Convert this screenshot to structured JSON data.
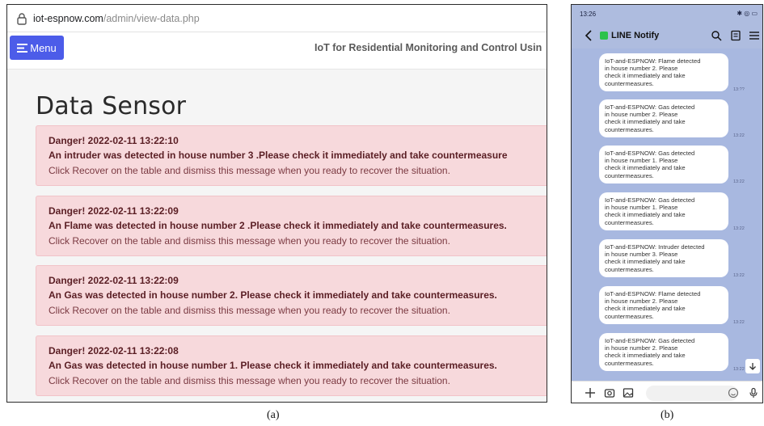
{
  "browser": {
    "url_domain": "iot-espnow.com",
    "url_path": "/admin/view-data.php"
  },
  "navbar": {
    "menu_label": "Menu",
    "title": "IoT for Residential Monitoring and Control Usin"
  },
  "page": {
    "title": "Data Sensor",
    "alerts": [
      {
        "heading": "Danger! 2022-02-11 13:22:10",
        "message": "An intruder was detected in house number 3 .Please check it immediately and take countermeasure",
        "footer": "Click Recover on the table and dismiss this message when you ready to recover the situation."
      },
      {
        "heading": "Danger! 2022-02-11 13:22:09",
        "message": "An Flame was detected in house number 2 .Please check it immediately and take countermeasures.",
        "footer": "Click Recover on the table and dismiss this message when you ready to recover the situation."
      },
      {
        "heading": "Danger! 2022-02-11 13:22:09",
        "message": "An Gas was detected in house number 2. Please check it immediately and take countermeasures.",
        "footer": "Click Recover on the table and dismiss this message when you ready to recover the situation."
      },
      {
        "heading": "Danger! 2022-02-11 13:22:08",
        "message": "An Gas was detected in house number 1. Please check it immediately and take countermeasures.",
        "footer": "Click Recover on the table and dismiss this message when you ready to recover the situation."
      }
    ]
  },
  "captions": {
    "a": "(a)",
    "b": "(b)"
  },
  "phone": {
    "status_time": "13:26",
    "status_icons": "✱ ◎ ▭",
    "chat_title": "LINE Notify",
    "messages": [
      {
        "text": "IoT-and-ESPNOW: Flame detected\nin house number 2. Please\ncheck it immediately and take\ncountermeasures.",
        "time": "13:??"
      },
      {
        "text": "IoT-and-ESPNOW: Gas detected\nin house number 2. Please\ncheck it immediately and take\ncountermeasures.",
        "time": "13:22"
      },
      {
        "text": "IoT-and-ESPNOW: Gas detected\nin house number 1. Please\ncheck it immediately and take\ncountermeasures.",
        "time": "13:22"
      },
      {
        "text": "IoT-and-ESPNOW: Gas detected\nin house number 1. Please\ncheck it immediately and take\ncountermeasures.",
        "time": "13:22"
      },
      {
        "text": "IoT-and-ESPNOW: Intruder detected\nin house number 3. Please\ncheck it immediately and take\ncountermeasures.",
        "time": "13:22"
      },
      {
        "text": "IoT-and-ESPNOW: Flame detected\nin house number 2. Please\ncheck it immediately and take\ncountermeasures.",
        "time": "13:22"
      },
      {
        "text": "IoT-and-ESPNOW: Gas detected\nin house number 2. Please\ncheck it immediately and take\ncountermeasures.",
        "time": "13:22"
      }
    ]
  },
  "colors": {
    "menu_button": "#4c5ce9",
    "alert_background": "#f7d9dc",
    "alert_text": "#5a1e24",
    "chat_background": "#a8b8e0",
    "line_green": "#2cc24c"
  }
}
